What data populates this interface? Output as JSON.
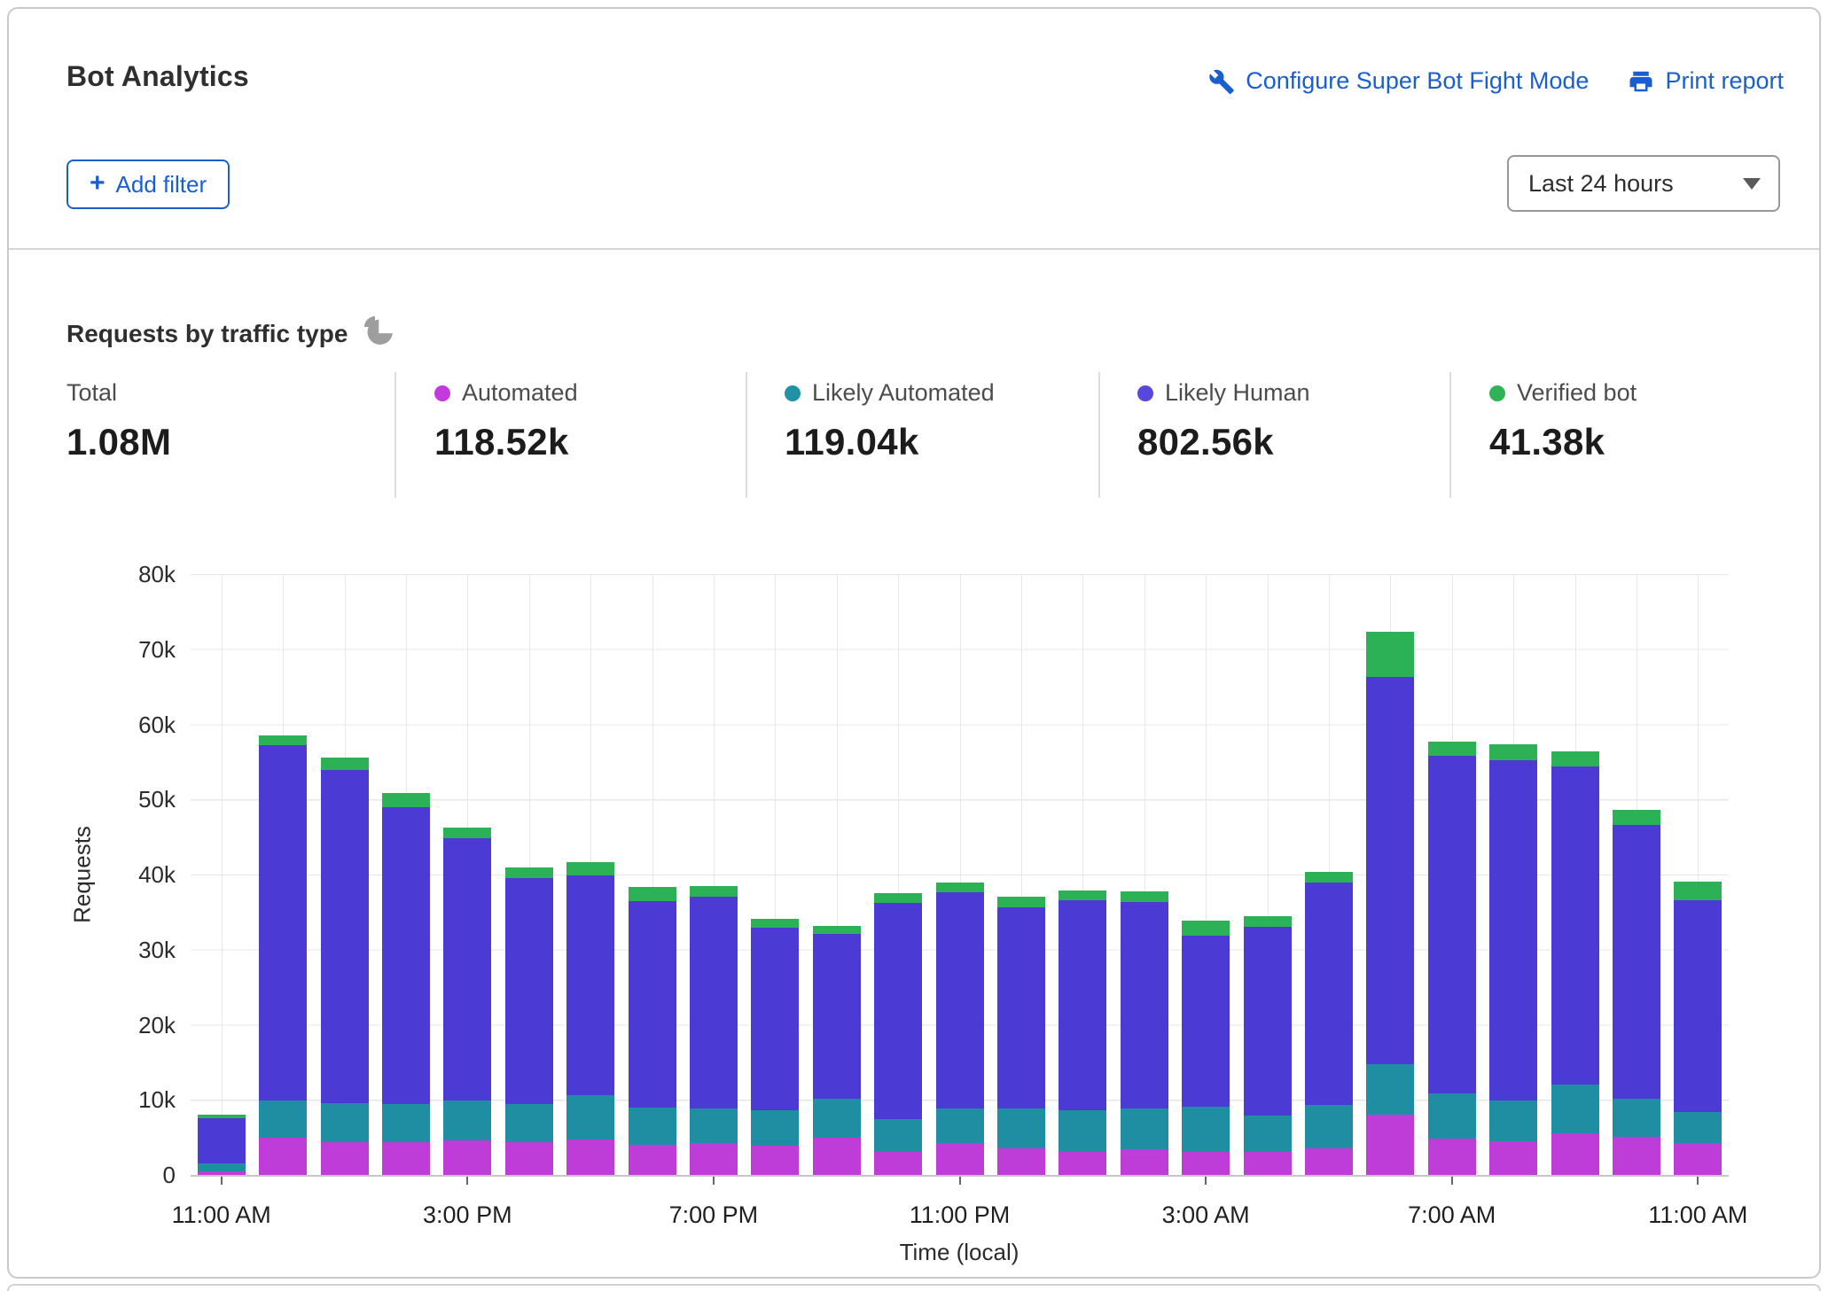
{
  "header": {
    "title": "Bot Analytics",
    "links": [
      {
        "label": "Configure Super Bot Fight Mode",
        "icon": "wrench-icon"
      },
      {
        "label": "Print report",
        "icon": "printer-icon"
      }
    ],
    "add_filter": {
      "plus": "+",
      "label": "Add filter"
    },
    "time_range_value": "Last 24 hours"
  },
  "section": {
    "title": "Requests by traffic type",
    "title_icon": "pie-chart-icon",
    "stats": [
      {
        "label": "Total",
        "value": "1.08M",
        "dot_color": ""
      },
      {
        "label": "Automated",
        "value": "118.52k",
        "dot_color": "#C43BDD"
      },
      {
        "label": "Likely Automated",
        "value": "119.04k",
        "dot_color": "#2191A5"
      },
      {
        "label": "Likely Human",
        "value": "802.56k",
        "dot_color": "#5747DC"
      },
      {
        "label": "Verified bot",
        "value": "41.38k",
        "dot_color": "#2EB457"
      }
    ]
  },
  "chart_data": {
    "type": "bar",
    "stacked": true,
    "title": "Requests by traffic type",
    "ylabel": "Requests",
    "xlabel": "Time (local)",
    "ylim": [
      0,
      80000
    ],
    "grid": true,
    "bar_count": 25,
    "interval": "1 hour",
    "ytick_labels": [
      "80k",
      "70k",
      "60k",
      "50k",
      "40k",
      "30k",
      "20k",
      "10k",
      "0"
    ],
    "xtick_labels": [
      "11:00 AM",
      "3:00 PM",
      "7:00 PM",
      "11:00 PM",
      "3:00 AM",
      "7:00 AM",
      "11:00 AM"
    ],
    "xtick_slots": [
      0,
      4,
      8,
      12,
      16,
      20,
      24
    ],
    "series": [
      {
        "name": "Automated",
        "color": "#BE3CD8",
        "values": [
          500,
          4900,
          4400,
          4400,
          4600,
          4400,
          4700,
          4000,
          4200,
          3900,
          5000,
          3100,
          4300,
          3600,
          3100,
          3400,
          3100,
          3100,
          3600,
          8000,
          4800,
          4500,
          5600,
          5100,
          4300
        ]
      },
      {
        "name": "Likely Automated",
        "color": "#1F8EA3",
        "values": [
          1000,
          5000,
          5200,
          5000,
          5300,
          5100,
          5900,
          5000,
          4600,
          4700,
          5100,
          4300,
          4600,
          5200,
          5500,
          5400,
          6000,
          4800,
          5700,
          6800,
          6100,
          5400,
          6400,
          5100,
          4100
        ]
      },
      {
        "name": "Likely Human",
        "color": "#4B3AD4",
        "values": [
          6100,
          47300,
          44300,
          39600,
          34900,
          30000,
          29300,
          27500,
          28200,
          24300,
          22000,
          28800,
          28800,
          26800,
          28000,
          27600,
          22800,
          25200,
          29600,
          51500,
          44900,
          45300,
          42400,
          36400,
          28200
        ]
      },
      {
        "name": "Verified bot",
        "color": "#2DB157",
        "values": [
          400,
          1300,
          1700,
          1900,
          1400,
          1500,
          1700,
          1800,
          1500,
          1200,
          1100,
          1300,
          1200,
          1400,
          1300,
          1400,
          2000,
          1400,
          1400,
          6000,
          1900,
          2100,
          2000,
          2000,
          2500
        ]
      }
    ]
  }
}
